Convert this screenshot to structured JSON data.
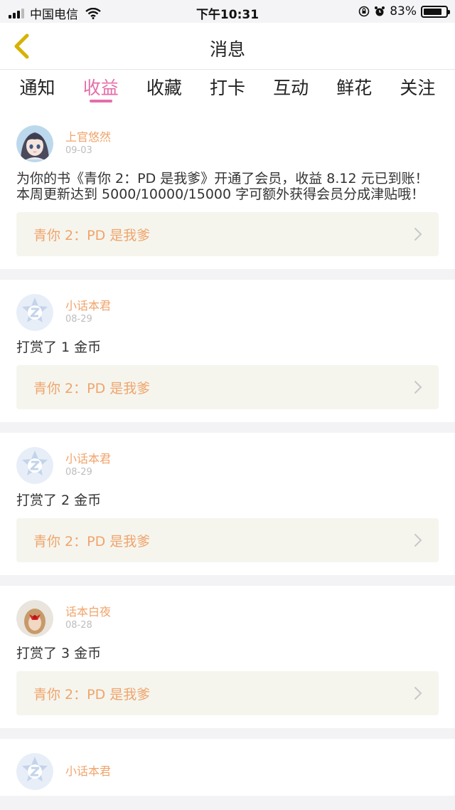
{
  "status_bar": {
    "carrier": "中国电信",
    "time": "下午10:31",
    "battery": "83%",
    "battery_level": 0.83
  },
  "nav": {
    "title": "消息"
  },
  "tabs": [
    {
      "label": "通知"
    },
    {
      "label": "收益"
    },
    {
      "label": "收藏"
    },
    {
      "label": "打卡"
    },
    {
      "label": "互动"
    },
    {
      "label": "鲜花"
    },
    {
      "label": "关注"
    }
  ],
  "active_tab": "收益",
  "messages": [
    {
      "user": "上官悠然",
      "date": "09-03",
      "text": "为你的书《青你 2：PD 是我爹》开通了会员，收益 8.12 元已到账！本周更新达到 5000/10000/15000 字可额外获得会员分成津贴哦！",
      "book": "青你 2：PD 是我爹",
      "avatar": "anime-girl-avatar"
    },
    {
      "user": "小话本君",
      "date": "08-29",
      "text": "打赏了 1 金币",
      "book": "青你 2：PD 是我爹",
      "avatar": "default-z-avatar"
    },
    {
      "user": "小话本君",
      "date": "08-29",
      "text": "打赏了 2 金币",
      "book": "青你 2：PD 是我爹",
      "avatar": "default-z-avatar"
    },
    {
      "user": "话本白夜",
      "date": "08-28",
      "text": "打赏了 3 金币",
      "book": "青你 2：PD 是我爹",
      "avatar": "photo-avatar"
    },
    {
      "user": "小话本君",
      "avatar": "default-z-avatar"
    }
  ],
  "colors": {
    "accent": "#e56ea9",
    "username": "#f0a46b",
    "back_arrow": "#d7b200",
    "link_bg": "#f5f5ee"
  }
}
